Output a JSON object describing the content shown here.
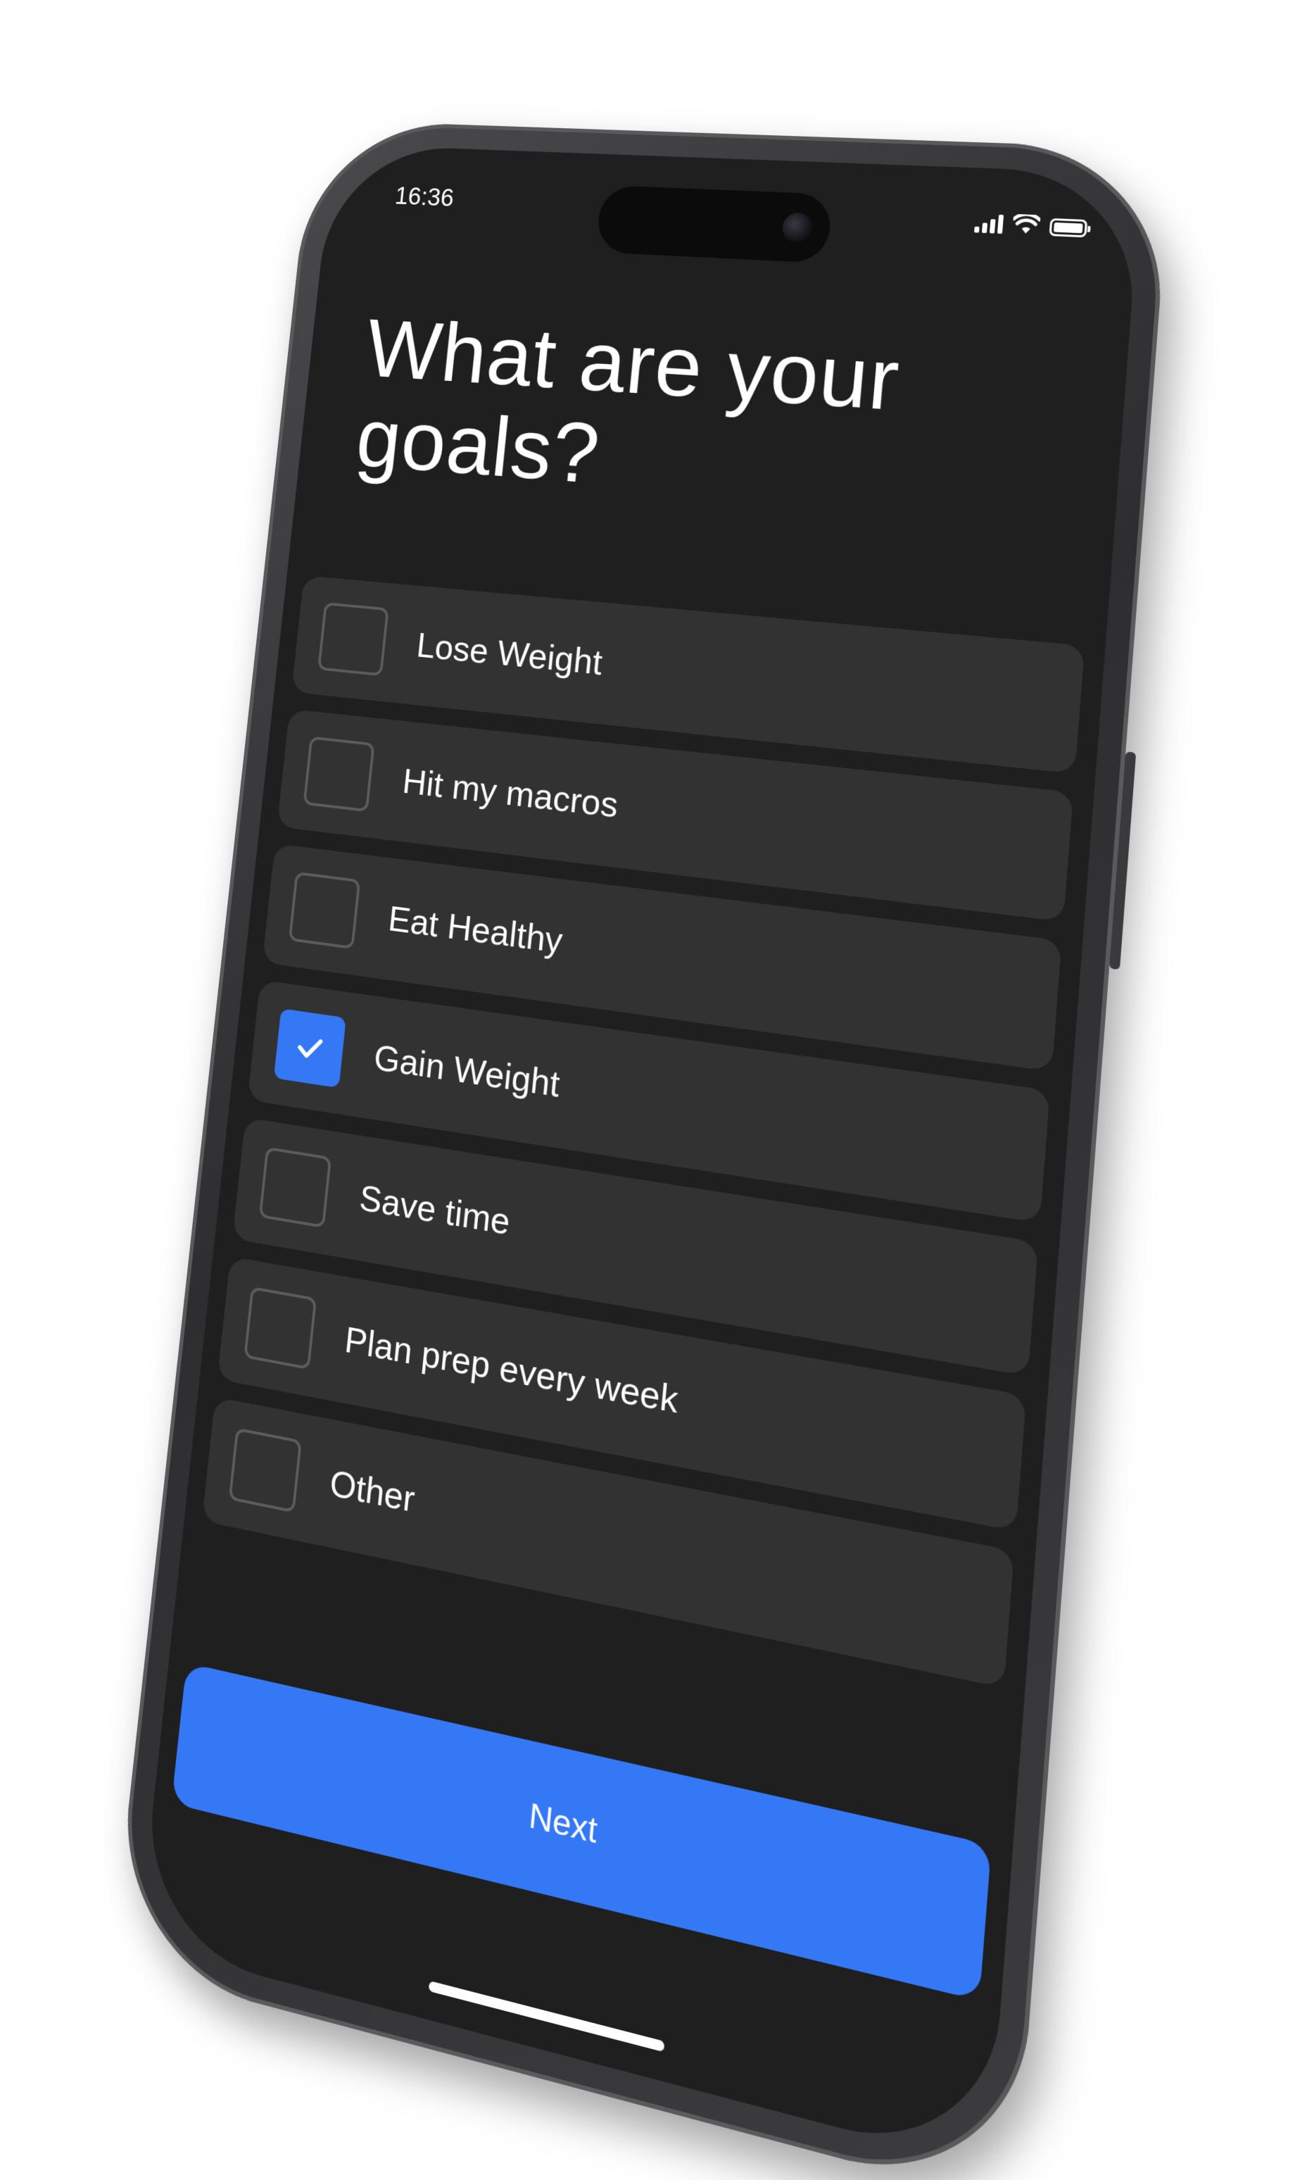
{
  "status_bar": {
    "time": "16:36",
    "signal_icon": "cellular-signal-icon",
    "wifi_icon": "wifi-icon",
    "battery_icon": "battery-icon"
  },
  "screen": {
    "title": "What are your goals?"
  },
  "goals": [
    {
      "label": "Lose Weight",
      "checked": false
    },
    {
      "label": "Hit my macros",
      "checked": false
    },
    {
      "label": "Eat Healthy",
      "checked": false
    },
    {
      "label": "Gain Weight",
      "checked": true
    },
    {
      "label": "Save time",
      "checked": false
    },
    {
      "label": "Plan prep every week",
      "checked": false
    },
    {
      "label": "Other",
      "checked": false
    }
  ],
  "next_button": {
    "label": "Next"
  },
  "colors": {
    "accent": "#3478f6",
    "screen_background": "#1f1f1f",
    "card_background": "#323232",
    "checkbox_border": "#5c5c5c"
  }
}
